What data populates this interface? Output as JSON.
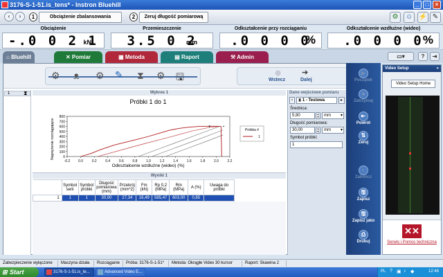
{
  "window": {
    "title": "3176-S-1-51.is_tens* - Instron Bluehill"
  },
  "toolbar": {
    "step1_num": "1",
    "step1_label": "Obciążenie zbalansowania",
    "step2_num": "2",
    "step2_label": "Zeruj długość pomiarową"
  },
  "readouts": [
    {
      "label": "Obciążenie",
      "value": "-.0 0 2 1",
      "unit": "kN"
    },
    {
      "label": "Przemieszczenie",
      "value": "3.5 0 2",
      "unit": "mm"
    },
    {
      "label": "Odkształcenie przy rozciąganiu",
      "value": ".0 0 0 0",
      "unit": "%"
    },
    {
      "label": "Odkształcenie wzdłużne (wideo)",
      "value": ".0 0 0 0",
      "unit": "%"
    }
  ],
  "tabs": {
    "home": "Bluehill",
    "pomiar": "Pomiar",
    "metoda": "Metoda",
    "raport": "Raport",
    "admin": "Admin"
  },
  "wizard": {
    "back": "Wstecz",
    "next": "Dalej"
  },
  "test_list": {
    "row1": "1"
  },
  "graph": {
    "title": "Wykres 1",
    "subtitle": "Próbki  1 do 1",
    "ylabel": "Naprężenie rozciągające",
    "xlabel": "Odkształcenie wzdłużne (wideo)  (%)",
    "legend_title": "Próbka #",
    "legend_item": "1"
  },
  "chart_data": {
    "type": "line",
    "xlim": [
      -0.2,
      2.2
    ],
    "ylim": [
      0,
      800
    ],
    "x_ticks": [
      "-0.2",
      "0.0",
      "0.2",
      "0.4",
      "0.6",
      "0.8",
      "1.0",
      "1.2",
      "1.4",
      "1.6",
      "1.8",
      "2.0",
      "2.2"
    ],
    "y_ticks": [
      "0",
      "100",
      "200",
      "300",
      "400",
      "500",
      "600",
      "700",
      "800"
    ],
    "series": [
      {
        "name": "1",
        "color": "#b01818",
        "x": [
          0.0,
          0.15,
          0.3,
          0.5,
          0.8,
          1.0,
          1.15,
          1.3,
          1.45,
          1.6,
          1.75,
          1.9,
          2.0,
          2.07,
          2.08
        ],
        "y": [
          0,
          60,
          140,
          230,
          330,
          400,
          460,
          520,
          560,
          585,
          598,
          603,
          603,
          600,
          0
        ]
      },
      {
        "name": "",
        "color": "#b01818",
        "x": [
          0.25,
          0.6,
          0.95,
          1.35,
          1.65,
          1.9,
          2.05
        ],
        "y": [
          0,
          130,
          260,
          400,
          510,
          580,
          603
        ]
      },
      {
        "name": "",
        "color": "#6a6a6a",
        "x": [
          0.85,
          1.15,
          1.45,
          1.75,
          2.05
        ],
        "y": [
          0,
          150,
          300,
          450,
          600
        ]
      },
      {
        "name": "",
        "color": "#6a6a6a",
        "x": [
          1.05,
          1.35,
          1.65,
          1.95,
          2.1
        ],
        "y": [
          0,
          150,
          300,
          450,
          530
        ]
      },
      {
        "name": "",
        "color": "#6a6a6a",
        "x": [
          1.25,
          1.55,
          1.85,
          2.1
        ],
        "y": [
          0,
          150,
          300,
          430
        ]
      }
    ]
  },
  "results": {
    "title": "Wyniki 1",
    "headers": [
      "Symbol serii",
      "Symbol próbki",
      "Długość pomiarowa (mm)",
      "Przekrój (mm^2)",
      "Fm (kN)",
      "Rp 0,2 (MPa)",
      "Rm (MPa)",
      "A (%)",
      "Uwaga do próbki"
    ],
    "row_index": "1",
    "row": [
      "1",
      "1",
      "30,00",
      "27,34",
      "16,49",
      "585,47",
      "603,00",
      "0,85",
      ""
    ]
  },
  "inputs": {
    "title": "Dane wejściowe pomiaru",
    "selector": "1 - Testowa",
    "diameter_label": "Średnica:",
    "diameter_value": "5,90",
    "diameter_unit": "mm",
    "gauge_label": "Długość pomiarowa:",
    "gauge_value": "30,00",
    "gauge_unit": "mm",
    "symbol_label": "Symbol próbki:",
    "symbol_value": "1"
  },
  "actions": {
    "start": "Początek",
    "stop": "Zatrzymaj",
    "return": "Powrót",
    "zero": "Zeruj",
    "finish": "Zakończ",
    "save": "Zapisz",
    "save_as": "Zapisz jako",
    "print": "Drukuj"
  },
  "video": {
    "title": "Video Setup",
    "home_button": "Video Setup Home",
    "service": "Serwis i Pomoc techniczna"
  },
  "status": [
    "Zabezpieczenie wyłączone",
    "Maszyna działa",
    "Rozciąganie",
    "Próba: 3176-S-1-51*",
    "Metoda: Okrągłe Video 30 kursor",
    "Raport: Skawina 2"
  ],
  "taskbar": {
    "start": "Start",
    "task1": "3176-S-1-51.is_te...",
    "task2": "Advanced Video E...",
    "lang": "PL",
    "clock": "12:46"
  },
  "colors": {
    "pomiar_tab": "#1f7a3a",
    "metoda_tab": "#b0283a",
    "raport_tab": "#1e7f7a",
    "admin_tab": "#9a1f4e",
    "selected_row": "#1f4fb0"
  }
}
